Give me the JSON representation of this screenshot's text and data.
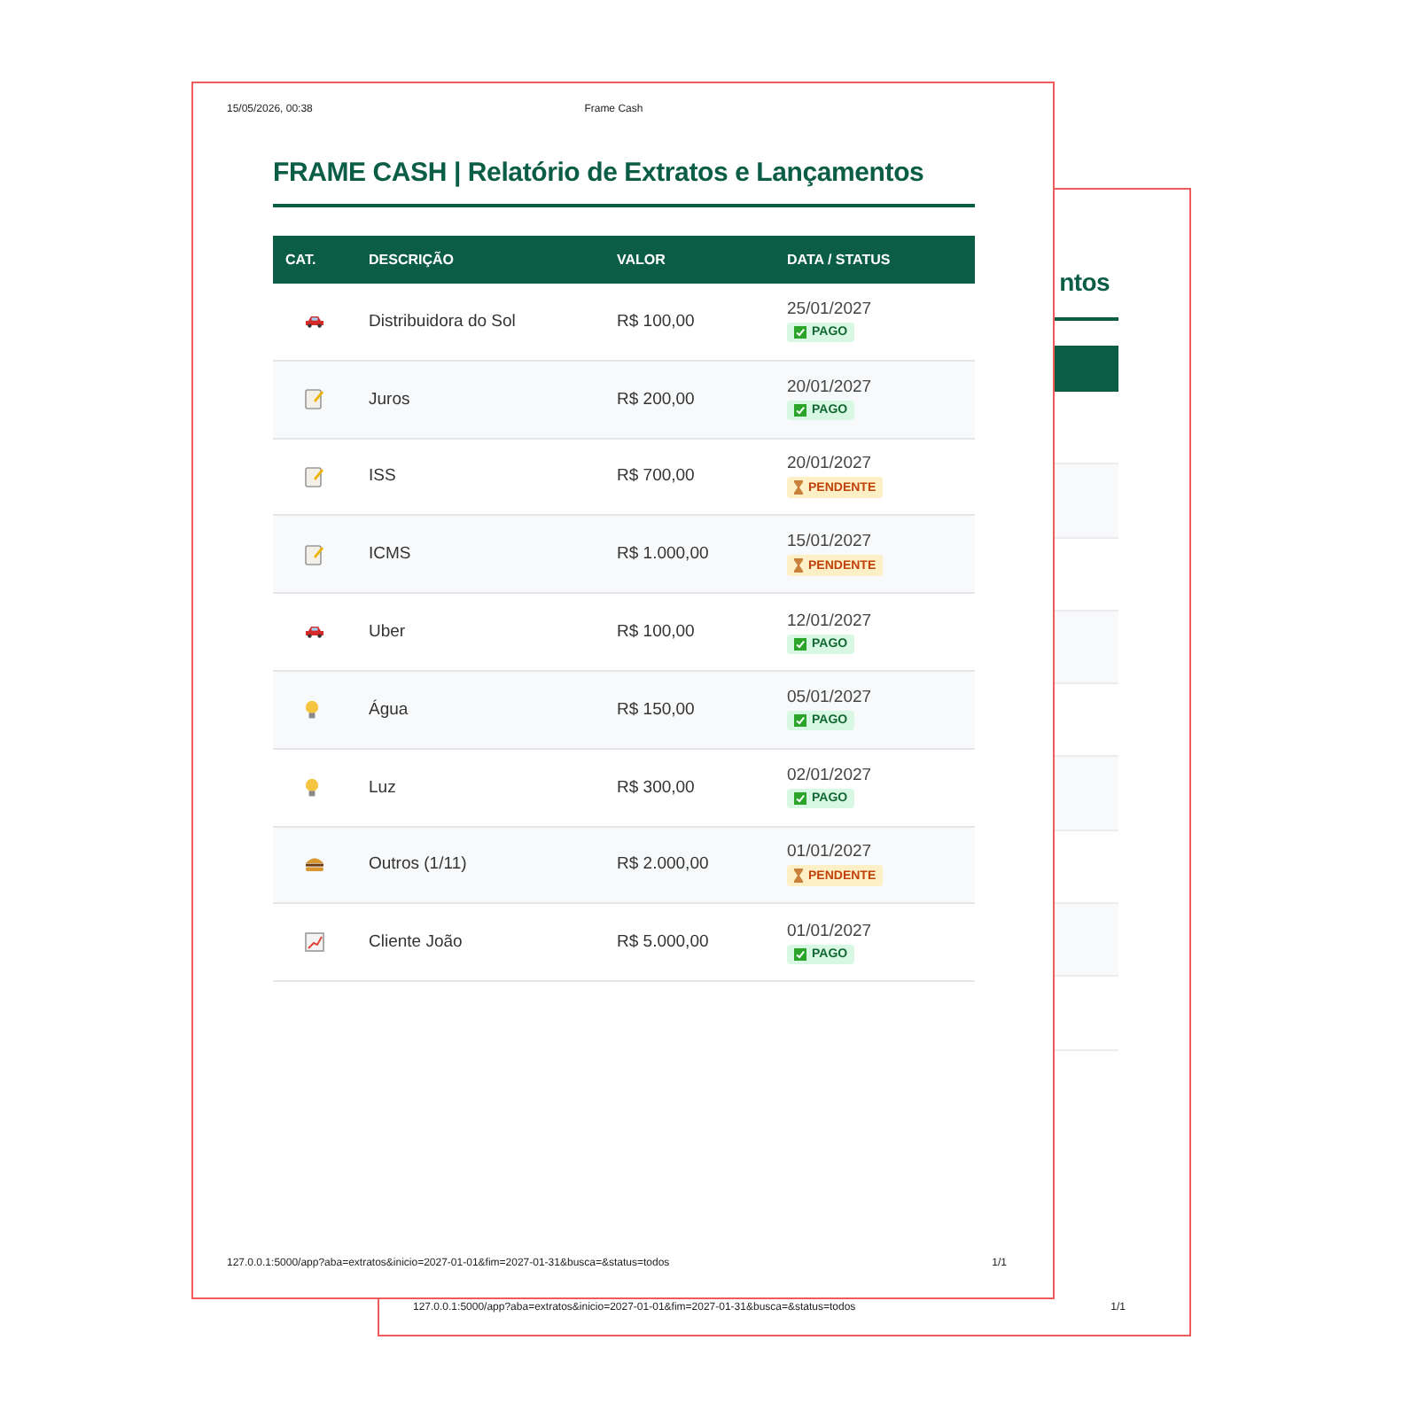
{
  "back_page": {
    "title": "ntos",
    "url": "127.0.0.1:5000/app?aba=extratos&inicio=2027-01-01&fim=2027-01-31&busca=&status=todos",
    "page_number": "1/1"
  },
  "front_page": {
    "print_date": "15/05/2026, 00:38",
    "print_title": "Frame Cash",
    "title": "FRAME CASH | Relatório de Extratos e Lançamentos",
    "columns": [
      "CAT.",
      "DESCRIÇÃO",
      "VALOR",
      "DATA / STATUS"
    ],
    "rows": [
      {
        "category": {
          "kind": "car"
        },
        "description": "Distribuidora do Sol",
        "value": "R$ 100,00",
        "date": "25/01/2027",
        "status": {
          "kind": "paid",
          "label": "PAGO"
        }
      },
      {
        "category": {
          "kind": "memo"
        },
        "description": "Juros",
        "value": "R$ 200,00",
        "date": "20/01/2027",
        "status": {
          "kind": "paid",
          "label": "PAGO"
        }
      },
      {
        "category": {
          "kind": "memo"
        },
        "description": "ISS",
        "value": "R$ 700,00",
        "date": "20/01/2027",
        "status": {
          "kind": "pending",
          "label": "PENDENTE"
        }
      },
      {
        "category": {
          "kind": "memo"
        },
        "description": "ICMS",
        "value": "R$ 1.000,00",
        "date": "15/01/2027",
        "status": {
          "kind": "pending",
          "label": "PENDENTE"
        }
      },
      {
        "category": {
          "kind": "car"
        },
        "description": "Uber",
        "value": "R$ 100,00",
        "date": "12/01/2027",
        "status": {
          "kind": "paid",
          "label": "PAGO"
        }
      },
      {
        "category": {
          "kind": "bulb"
        },
        "description": "Água",
        "value": "R$ 150,00",
        "date": "05/01/2027",
        "status": {
          "kind": "paid",
          "label": "PAGO"
        }
      },
      {
        "category": {
          "kind": "bulb"
        },
        "description": "Luz",
        "value": "R$ 300,00",
        "date": "02/01/2027",
        "status": {
          "kind": "paid",
          "label": "PAGO"
        }
      },
      {
        "category": {
          "kind": "burger"
        },
        "description": "Outros (1/11)",
        "value": "R$ 2.000,00",
        "date": "01/01/2027",
        "status": {
          "kind": "pending",
          "label": "PENDENTE"
        }
      },
      {
        "category": {
          "kind": "chart"
        },
        "description": "Cliente João",
        "value": "R$ 5.000,00",
        "date": "01/01/2027",
        "status": {
          "kind": "paid",
          "label": "PAGO"
        }
      }
    ],
    "url": "127.0.0.1:5000/app?aba=extratos&inicio=2027-01-01&fim=2027-01-31&busca=&status=todos",
    "page_number": "1/1"
  }
}
